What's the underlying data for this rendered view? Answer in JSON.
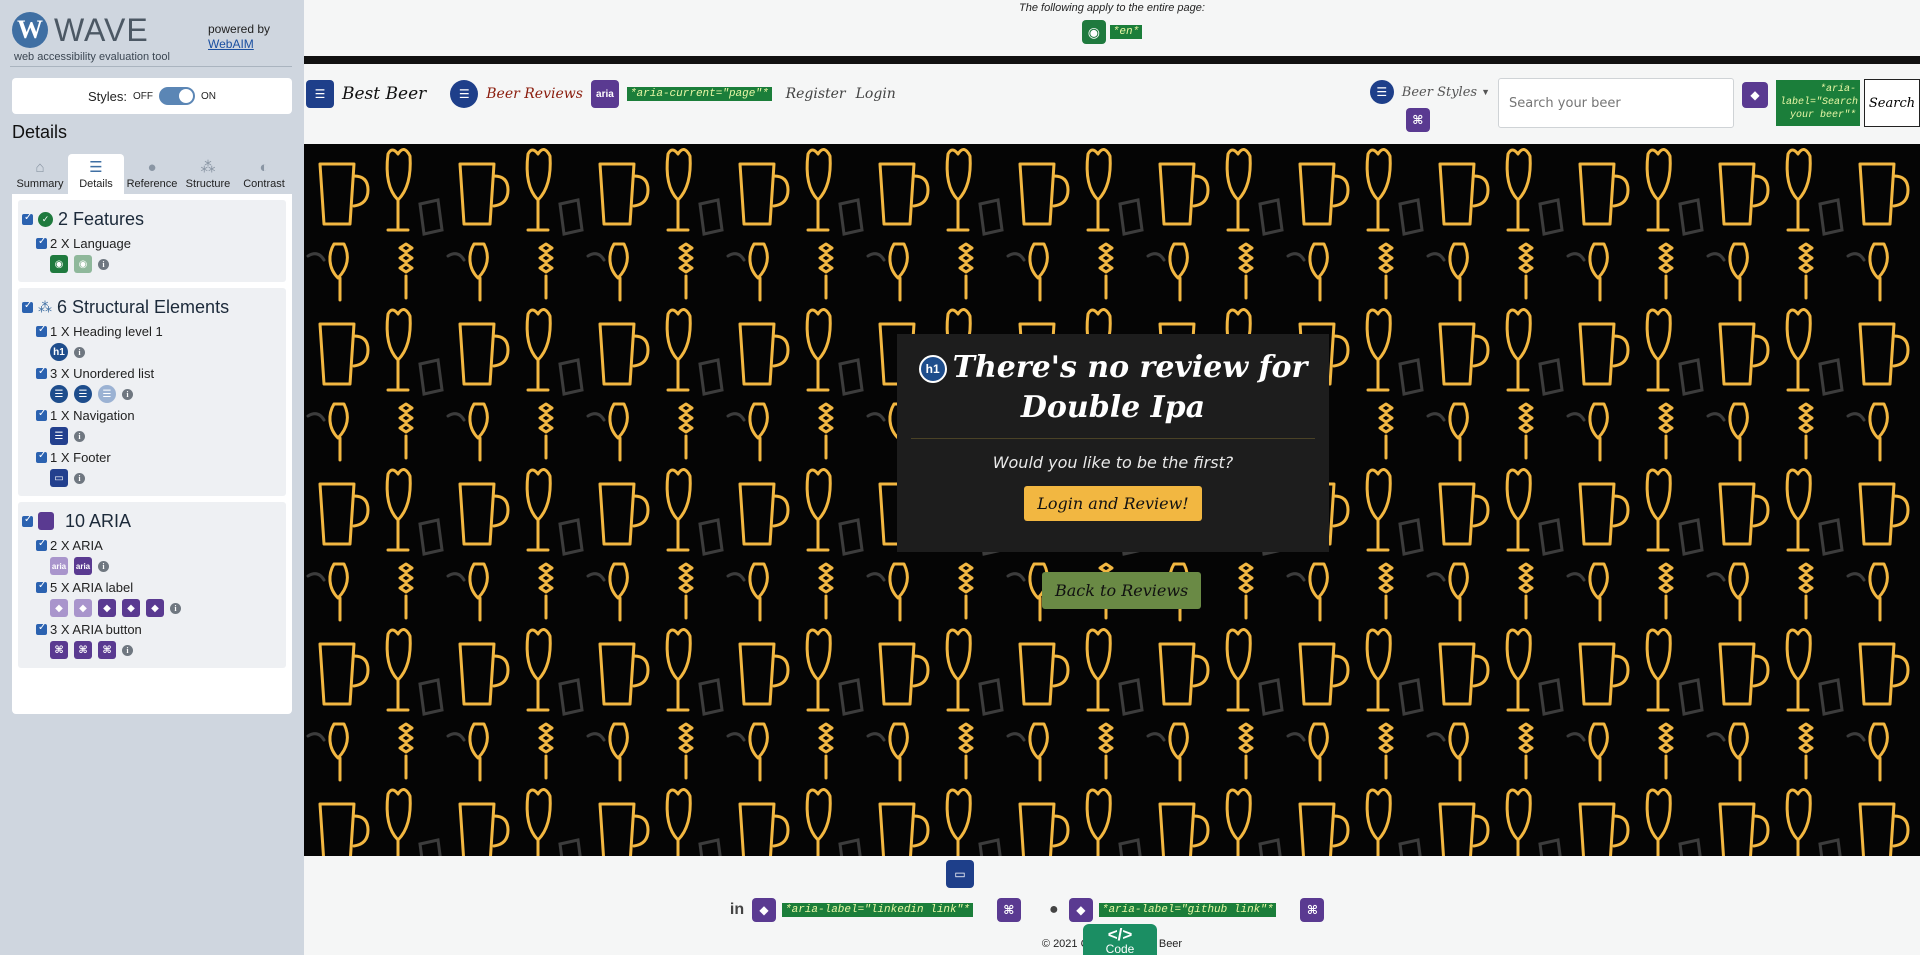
{
  "wave": {
    "logo_letter": "W",
    "title": "WAVE",
    "subtitle": "web accessibility evaluation tool",
    "powered_by": "powered by",
    "webaim_link": "WebAIM",
    "styles_label": "Styles:",
    "styles_off": "OFF",
    "styles_on": "ON",
    "details_heading": "Details",
    "tabs": [
      {
        "label": "Summary",
        "icon": "home-icon"
      },
      {
        "label": "Details",
        "icon": "list-icon"
      },
      {
        "label": "Reference",
        "icon": "info-icon"
      },
      {
        "label": "Structure",
        "icon": "structure-icon"
      },
      {
        "label": "Contrast",
        "icon": "contrast-icon"
      }
    ],
    "groups": {
      "features": {
        "title": "2 Features",
        "items": [
          {
            "label": "2 X Language"
          }
        ]
      },
      "structure": {
        "title": "6 Structural Elements",
        "items": [
          {
            "label": "1 X Heading level 1"
          },
          {
            "label": "3 X Unordered list"
          },
          {
            "label": "1 X Navigation"
          },
          {
            "label": "1 X Footer"
          }
        ]
      },
      "aria": {
        "title": "10 ARIA",
        "items": [
          {
            "label": "2 X ARIA"
          },
          {
            "label": "5 X ARIA label"
          },
          {
            "label": "3 X ARIA button"
          }
        ]
      }
    },
    "icon_text": {
      "h1": "h1",
      "aria": "aria",
      "info": "i"
    }
  },
  "page": {
    "apply_note": "The following apply to the entire page:",
    "lang_tag": "*en*",
    "nav": {
      "brand": "Best Beer",
      "beer_reviews": "Beer Reviews",
      "aria_current": "*aria-current=\"page\"*",
      "register": "Register",
      "login": "Login",
      "beer_styles": "Beer Styles",
      "search_placeholder": "Search your beer",
      "search_aria": "*aria-label=\"Search your beer\"*",
      "search_button": "Search"
    },
    "hero": {
      "heading": "There's no review for Double Ipa",
      "subtext": "Would you like to be the first?",
      "cta": "Login and Review!",
      "back": "Back to Reviews"
    },
    "footer": {
      "linkedin_glyph": "in",
      "linkedin_aria": "*aria-label=\"linkedin link\"*",
      "github_aria": "*aria-label=\"github link\"*",
      "copyright": "© 2021 Copyright: Best Beer",
      "code_glyph": "</>",
      "code_label": "Code"
    }
  },
  "colors": {
    "wave_blue": "#3f6fa3",
    "feature_green": "#1f7a3e",
    "aria_purple": "#5a3a91",
    "hero_pattern": "#f2b741",
    "cta_yellow": "#f2b741",
    "back_green": "#6a8a45"
  }
}
